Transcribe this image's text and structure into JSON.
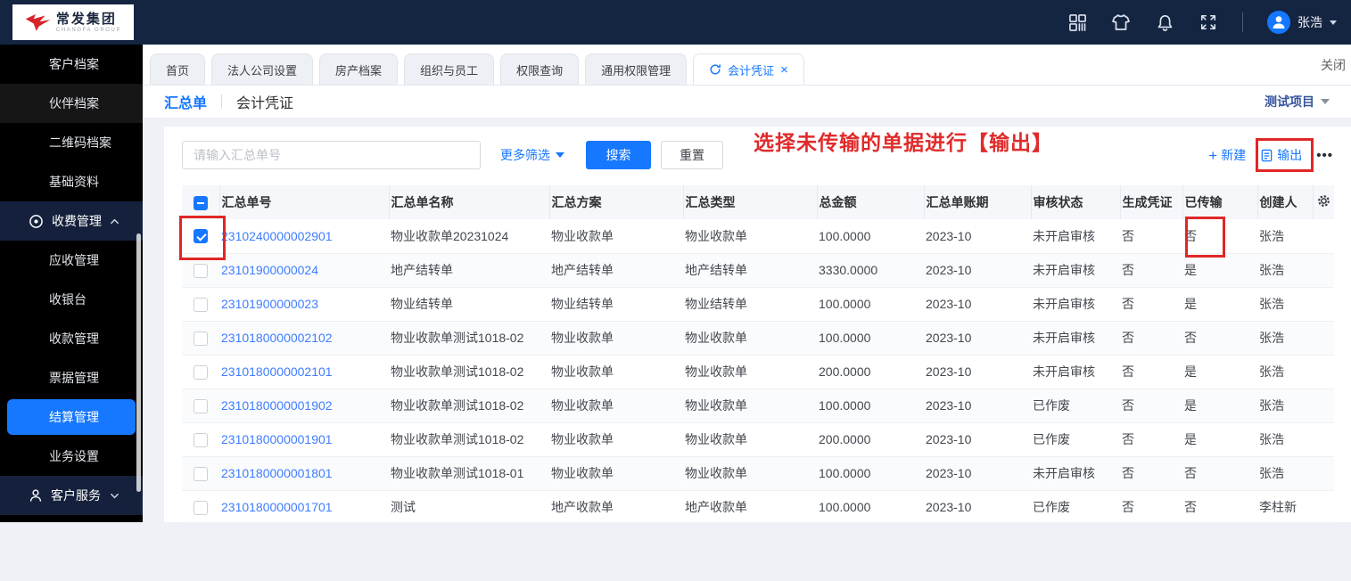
{
  "colors": {
    "accent": "#1677ff",
    "topbar_bg": "#142542",
    "annotation_red": "#e12626",
    "link_blue": "#3f7dff"
  },
  "topbar": {
    "logo": {
      "cn": "常发集团",
      "en": "CHANGFA GROUP"
    },
    "icons": [
      "apps-icon",
      "tshirt-icon",
      "bell-icon",
      "fullscreen-icon"
    ],
    "user": {
      "name": "张浩"
    }
  },
  "sidebar": {
    "items": [
      {
        "label": "客户档案",
        "type": "sub"
      },
      {
        "label": "伙伴档案",
        "type": "sub",
        "highlight": true
      },
      {
        "label": "二维码档案",
        "type": "sub"
      },
      {
        "label": "基础资料",
        "type": "sub"
      },
      {
        "label": "收费管理",
        "type": "parent",
        "icon": "target-icon",
        "expanded": true
      },
      {
        "label": "应收管理",
        "type": "sub"
      },
      {
        "label": "收银台",
        "type": "sub"
      },
      {
        "label": "收款管理",
        "type": "sub"
      },
      {
        "label": "票据管理",
        "type": "sub"
      },
      {
        "label": "结算管理",
        "type": "sub",
        "active": true
      },
      {
        "label": "业务设置",
        "type": "sub"
      },
      {
        "label": "客户服务",
        "type": "parent",
        "icon": "person-icon",
        "expanded": false
      }
    ]
  },
  "tabs": {
    "items": [
      {
        "label": "首页"
      },
      {
        "label": "法人公司设置"
      },
      {
        "label": "房产档案"
      },
      {
        "label": "组织与员工"
      },
      {
        "label": "权限查询"
      },
      {
        "label": "通用权限管理"
      },
      {
        "label": "会计凭证",
        "active": true,
        "refresh_icon": "refresh-icon",
        "closable": true
      }
    ],
    "close_label": "关闭"
  },
  "page_head": {
    "tabs": [
      {
        "label": "汇总单",
        "active": true
      },
      {
        "label": "会计凭证",
        "active": false
      }
    ],
    "project": "测试项目"
  },
  "filter": {
    "placeholder": "请输入汇总单号",
    "more_label": "更多筛选",
    "search_label": "搜索",
    "reset_label": "重置"
  },
  "actions": {
    "new_label": "新建",
    "export_label": "输出",
    "more_icon": "ellipsis-icon"
  },
  "annotation": {
    "text": "选择未传输的单据进行【输出】"
  },
  "table": {
    "headers": [
      "汇总单号",
      "汇总单名称",
      "汇总方案",
      "汇总类型",
      "总金额",
      "汇总单账期",
      "审核状态",
      "生成凭证",
      "已传输",
      "创建人"
    ],
    "rows": [
      {
        "checked": true,
        "no": "2310240000002901",
        "name": "物业收款单20231024",
        "plan": "物业收款单",
        "type": "物业收款单",
        "amount": "100.0000",
        "period": "2023-10",
        "audit": "未开启审核",
        "voucher": "否",
        "transmitted": "否",
        "creator": "张浩"
      },
      {
        "checked": false,
        "no": "23101900000024",
        "name": "地产结转单",
        "plan": "地产结转单",
        "type": "地产结转单",
        "amount": "3330.0000",
        "period": "2023-10",
        "audit": "未开启审核",
        "voucher": "否",
        "transmitted": "是",
        "creator": "张浩"
      },
      {
        "checked": false,
        "no": "23101900000023",
        "name": "物业结转单",
        "plan": "物业结转单",
        "type": "物业结转单",
        "amount": "100.0000",
        "period": "2023-10",
        "audit": "未开启审核",
        "voucher": "否",
        "transmitted": "是",
        "creator": "张浩"
      },
      {
        "checked": false,
        "no": "2310180000002102",
        "name": "物业收款单测试1018-02",
        "plan": "物业收款单",
        "type": "物业收款单",
        "amount": "100.0000",
        "period": "2023-10",
        "audit": "未开启审核",
        "voucher": "否",
        "transmitted": "否",
        "creator": "张浩"
      },
      {
        "checked": false,
        "no": "2310180000002101",
        "name": "物业收款单测试1018-02",
        "plan": "物业收款单",
        "type": "物业收款单",
        "amount": "200.0000",
        "period": "2023-10",
        "audit": "未开启审核",
        "voucher": "否",
        "transmitted": "是",
        "creator": "张浩"
      },
      {
        "checked": false,
        "no": "2310180000001902",
        "name": "物业收款单测试1018-02",
        "plan": "物业收款单",
        "type": "物业收款单",
        "amount": "100.0000",
        "period": "2023-10",
        "audit": "已作废",
        "voucher": "否",
        "transmitted": "是",
        "creator": "张浩"
      },
      {
        "checked": false,
        "no": "2310180000001901",
        "name": "物业收款单测试1018-02",
        "plan": "物业收款单",
        "type": "物业收款单",
        "amount": "200.0000",
        "period": "2023-10",
        "audit": "已作废",
        "voucher": "否",
        "transmitted": "是",
        "creator": "张浩"
      },
      {
        "checked": false,
        "no": "2310180000001801",
        "name": "物业收款单测试1018-01",
        "plan": "物业收款单",
        "type": "物业收款单",
        "amount": "100.0000",
        "period": "2023-10",
        "audit": "未开启审核",
        "voucher": "否",
        "transmitted": "否",
        "creator": "张浩"
      },
      {
        "checked": false,
        "no": "2310180000001701",
        "name": "测试",
        "plan": "地产收款单",
        "type": "地产收款单",
        "amount": "100.0000",
        "period": "2023-10",
        "audit": "已作废",
        "voucher": "否",
        "transmitted": "否",
        "creator": "李柱新"
      }
    ]
  }
}
